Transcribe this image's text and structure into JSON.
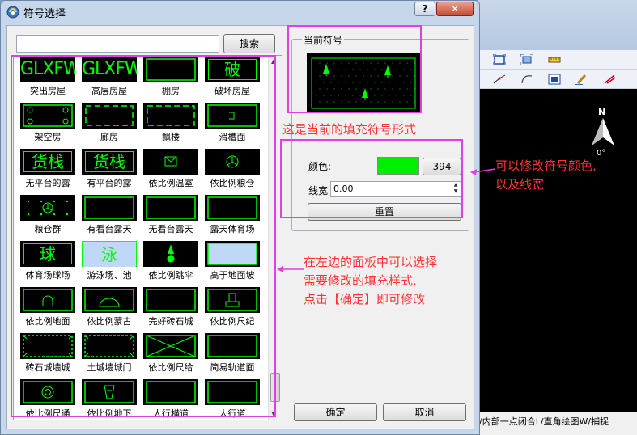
{
  "dialog": {
    "title": "符号选择",
    "help": "?",
    "close": "✕",
    "search_btn": "搜索",
    "search_value": "",
    "group_legend": "当前符号",
    "color_label": "颜色:",
    "color_value": "394",
    "color_hex": "#00ee00",
    "linewidth_label": "线宽",
    "linewidth_value": "0.00",
    "reset_btn": "重置",
    "ok_btn": "确定",
    "cancel_btn": "取消"
  },
  "symbols": [
    {
      "label": "突出房屋",
      "sym": "t:GLXFWG"
    },
    {
      "label": "高层房屋",
      "sym": "t:GLXFWG"
    },
    {
      "label": "棚房",
      "sym": "rect"
    },
    {
      "label": "破坏房屋",
      "sym": "t:破"
    },
    {
      "label": "架空房",
      "sym": "circles"
    },
    {
      "label": "廊房",
      "sym": "dashrect"
    },
    {
      "label": "飘楼",
      "sym": "dashrect"
    },
    {
      "label": "滑槽面",
      "sym": "bracket"
    },
    {
      "label": "无平台的露",
      "sym": "t:货栈"
    },
    {
      "label": "有平台的露",
      "sym": "t:货栈"
    },
    {
      "label": "依比例温室",
      "sym": "envelope"
    },
    {
      "label": "依比例粮仓",
      "sym": "ycircle"
    },
    {
      "label": "粮仓群",
      "sym": "dots-ycircle"
    },
    {
      "label": "有看台露天",
      "sym": "rect"
    },
    {
      "label": "无看台露天",
      "sym": "rect"
    },
    {
      "label": "露天体育场",
      "sym": "rect"
    },
    {
      "label": "体育场球场",
      "sym": "t:球"
    },
    {
      "label": "游泳场、池",
      "sym": "t:泳"
    },
    {
      "label": "依比例跳伞",
      "sym": "parachute"
    },
    {
      "label": "高于地面坡",
      "sym": "bluefill"
    },
    {
      "label": "依比例地面",
      "sym": "arch"
    },
    {
      "label": "依比例蒙古",
      "sym": "dome"
    },
    {
      "label": "完好砖石城",
      "sym": "rect"
    },
    {
      "label": "依比例尺纪",
      "sym": "monument"
    },
    {
      "label": "砖石城墙城",
      "sym": "dashedge"
    },
    {
      "label": "土城墙城门",
      "sym": "dashedge"
    },
    {
      "label": "依比例尺给",
      "sym": "xbox"
    },
    {
      "label": "简易轨道面",
      "sym": "rect"
    },
    {
      "label": "依比例尺通",
      "sym": "target"
    },
    {
      "label": "依比例地下",
      "sym": "cup"
    },
    {
      "label": "人行横道",
      "sym": "rect"
    },
    {
      "label": "人行道",
      "sym": "rect"
    }
  ],
  "annotations": {
    "preview_note": "这是当前的填充符号形式",
    "color_note_1": "可以修改符号颜色,",
    "color_note_2": "以及线宽",
    "list_note_1": "在左边的面板中可以选择",
    "list_note_2": "需要修改的填充样式,",
    "list_note_3": "点击【确定】即可修改"
  },
  "background_app": {
    "compass": "N",
    "compass_deg": "0°",
    "status_text": "/内部一点闭合L/直角绘图W/捕捉"
  },
  "colors": {
    "symbol_green": "#00ff00",
    "annotation": "#ff3333",
    "highlight": "#e040e0"
  }
}
